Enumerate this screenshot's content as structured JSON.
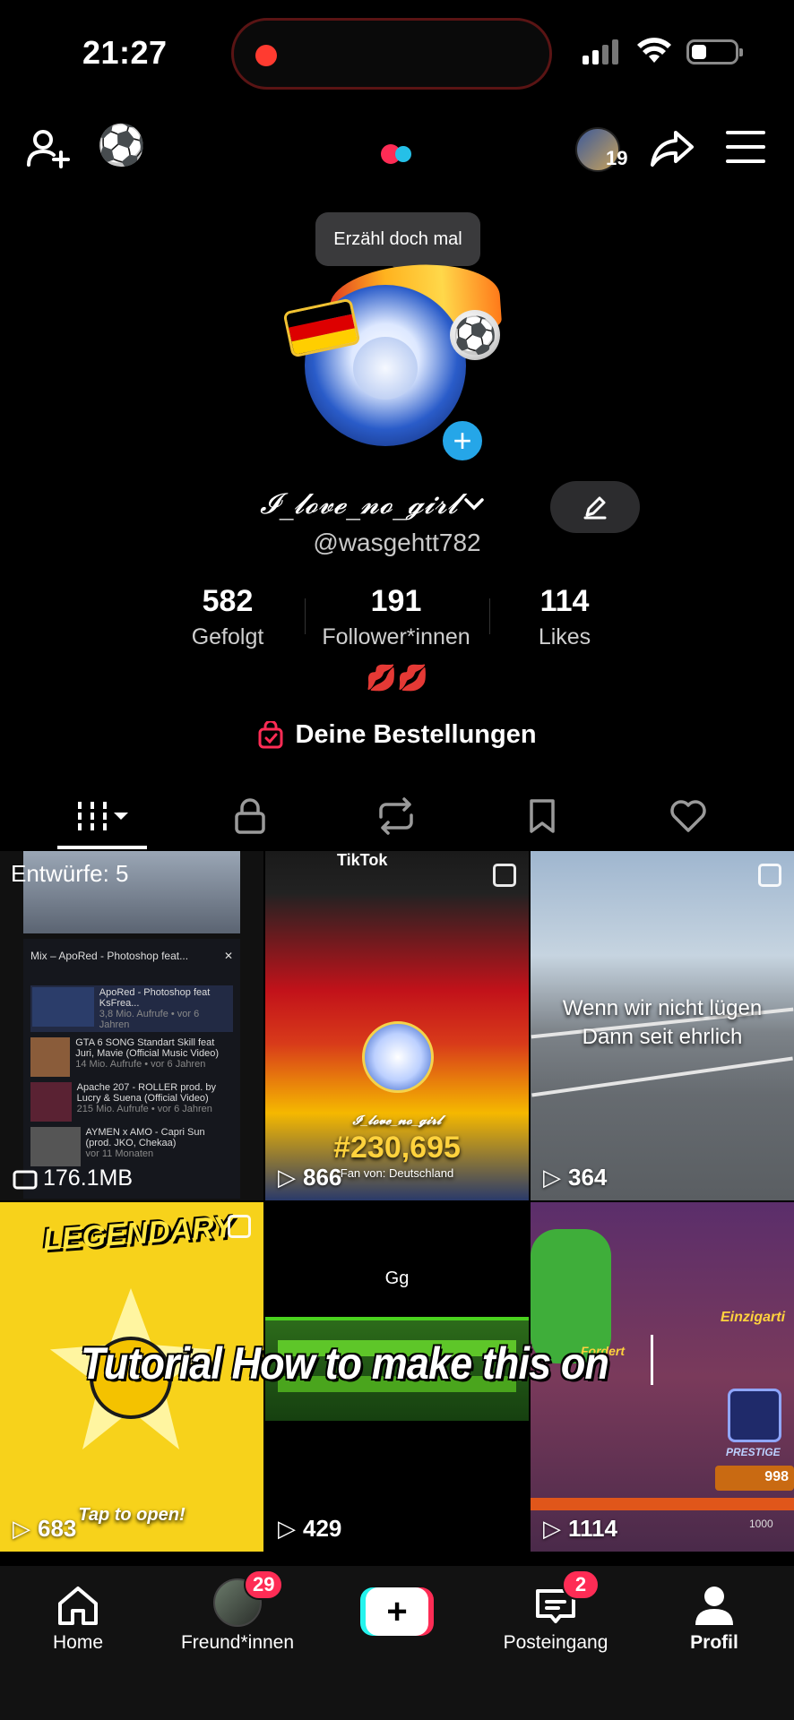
{
  "status_bar": {
    "time": "21:27",
    "battery_level": 0.35
  },
  "top_nav": {
    "friend_count": "19",
    "emoji": "⚽"
  },
  "profile": {
    "tooltip": "Erzähl doch mal",
    "display_name": "𝓘_𝓵𝓸𝓿𝓮_𝓷𝓸_𝓰𝓲𝓻𝓵",
    "username": "@wasgehtt782",
    "flag_colors": [
      "#000000",
      "#dd0000",
      "#ffce00"
    ],
    "stats": [
      {
        "value": "582",
        "label": "Gefolgt"
      },
      {
        "value": "191",
        "label": "Follower*innen"
      },
      {
        "value": "114",
        "label": "Likes"
      }
    ],
    "bio": "💋💋",
    "orders_label": "Deine Bestellungen"
  },
  "tabs": [
    {
      "icon": "grid-icon",
      "active": true
    },
    {
      "icon": "lock-icon",
      "active": false
    },
    {
      "icon": "repost-icon",
      "active": false
    },
    {
      "icon": "bookmark-icon",
      "active": false
    },
    {
      "icon": "heart-icon",
      "active": false
    }
  ],
  "videos": {
    "drafts": {
      "label": "Entwürfe: 5",
      "size": "176.1MB",
      "mix_title": "Mix – ApoRed - Photoshop feat...",
      "list_items": [
        {
          "title": "ApoRed - Photoshop feat KsFrea...",
          "meta": "3,8 Mio. Aufrufe • vor 6 Jahren"
        },
        {
          "title": "GTA 6 SONG Standart Skill feat Juri, Mavie (Official Music Video)",
          "meta": "14 Mio. Aufrufe • vor 6 Jahren"
        },
        {
          "title": "Apache 207 - ROLLER prod. by Lucry & Suena (Official Video)",
          "meta": "215 Mio. Aufrufe • vor 6 Jahren"
        },
        {
          "title": "AYMEN x AMO - Capri Sun (prod. JKO, Chekaa)",
          "meta": "vor 11 Monaten"
        }
      ]
    },
    "items": [
      {
        "views": "866",
        "tiktok": "TikTok",
        "caption_number": "#230,695",
        "caption_sub": "Fan von: Deutschland",
        "name_overlay": "𝓘_𝓵𝓸𝓿𝓮_𝓷𝓸_𝓰𝓲𝓻𝓵"
      },
      {
        "views": "364",
        "caption_line1": "Wenn wir nicht lügen",
        "caption_line2": "Dann seit ehrlich"
      },
      {
        "views": "683",
        "title": "LEGENDARY",
        "sub": "Tap to open!"
      },
      {
        "views": "429",
        "title": "Gg"
      },
      {
        "views": "1114",
        "label1": "Einzigarti",
        "label2": "PRESTIGE",
        "label3": "998",
        "label4": "Fordert",
        "label5": "1000"
      }
    ],
    "overlay_text": "Tutorial How to make this on"
  },
  "bottom_nav": {
    "home": "Home",
    "friends": "Freund*innen",
    "friends_badge": "29",
    "inbox": "Posteingang",
    "inbox_badge": "2",
    "profile": "Profil"
  }
}
